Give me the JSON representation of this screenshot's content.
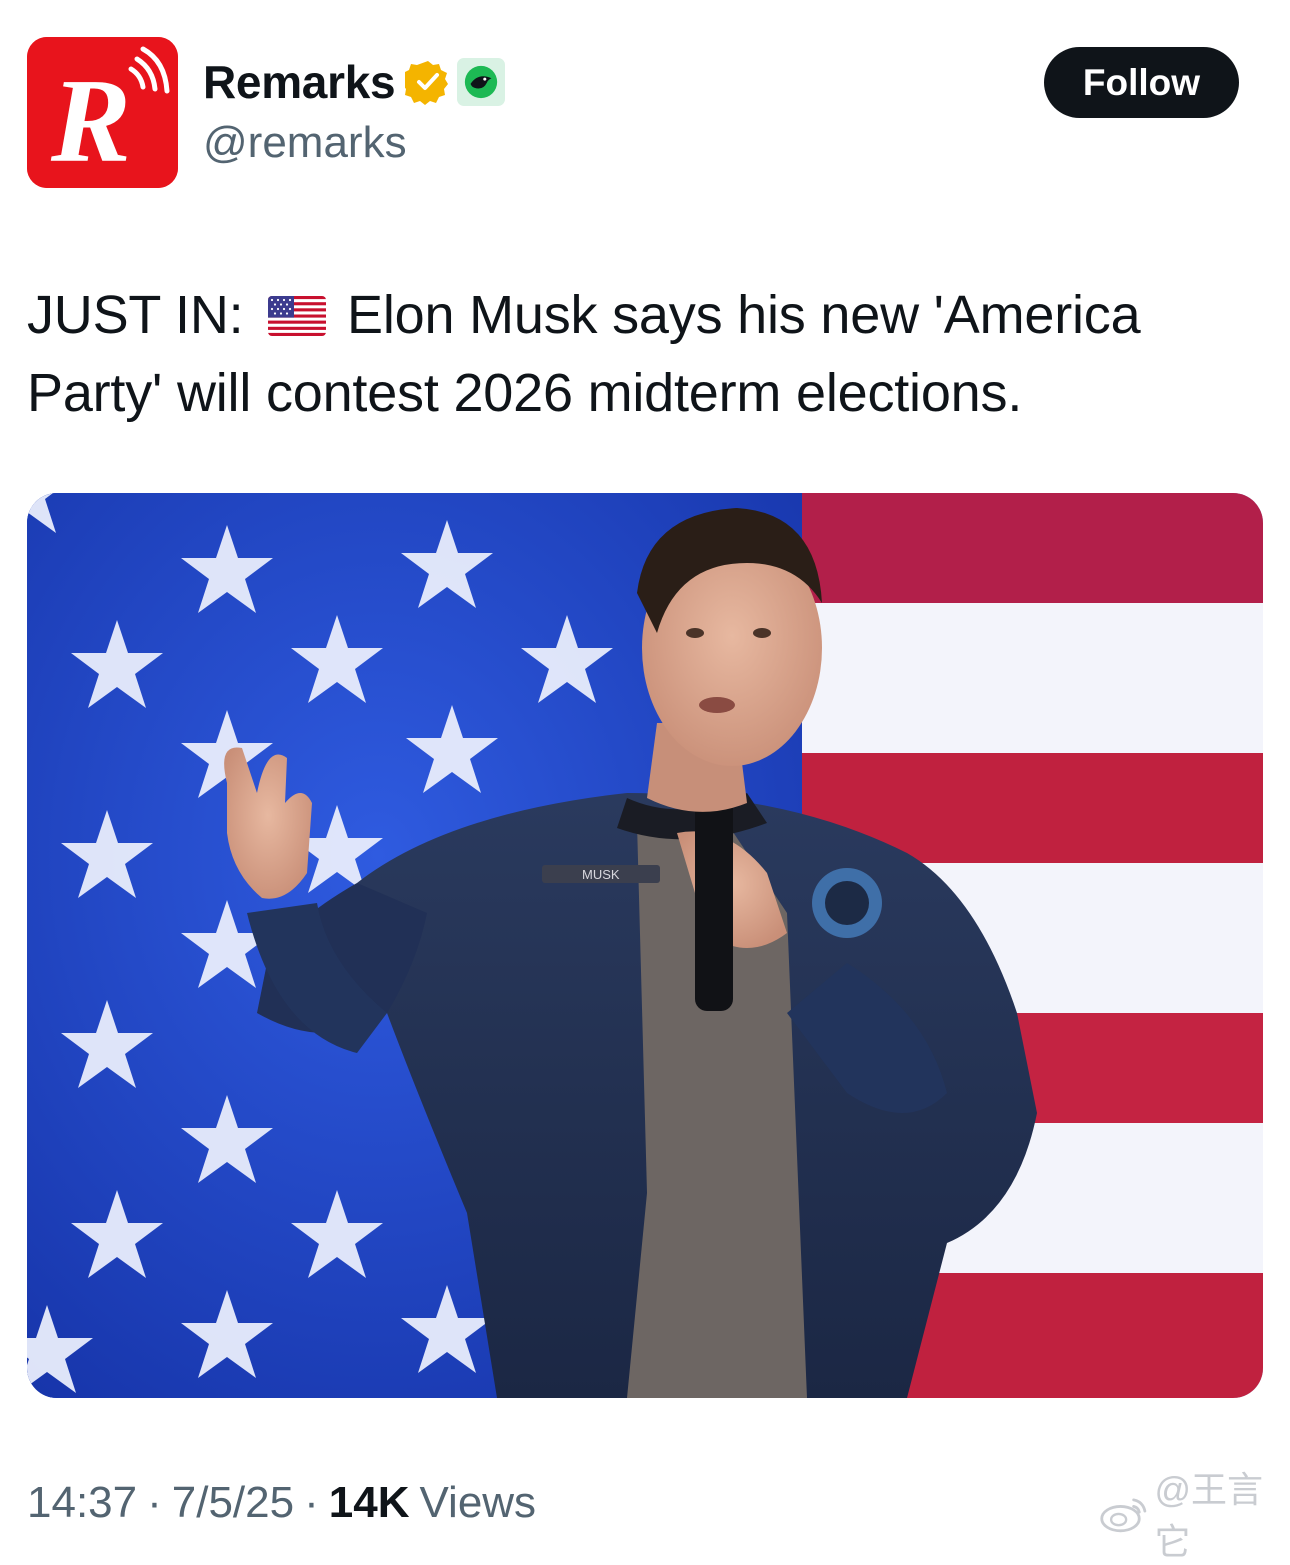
{
  "account": {
    "name": "Remarks",
    "handle": "@remarks",
    "avatar_letter": "R",
    "brand_color": "#e8141c",
    "verified_badge_color": "#f4b400",
    "affiliate_badge_color": "#1db954"
  },
  "header": {
    "follow_label": "Follow"
  },
  "tweet": {
    "prefix": "JUST IN:",
    "flag_emoji_icon": "us-flag-icon",
    "body": "Elon Musk says his new 'America Party' will contest 2026 midterm elections."
  },
  "media": {
    "jacket_name_tag": "MUSK",
    "flag_colors": {
      "blue": "#1d44c4",
      "red": "#c0213f",
      "white": "#f4f6ff"
    }
  },
  "footer": {
    "time": "14:37",
    "separator": "·",
    "date": "7/5/25",
    "views_count": "14K",
    "views_label": "Views"
  },
  "watermark": {
    "text": "@王言它"
  }
}
